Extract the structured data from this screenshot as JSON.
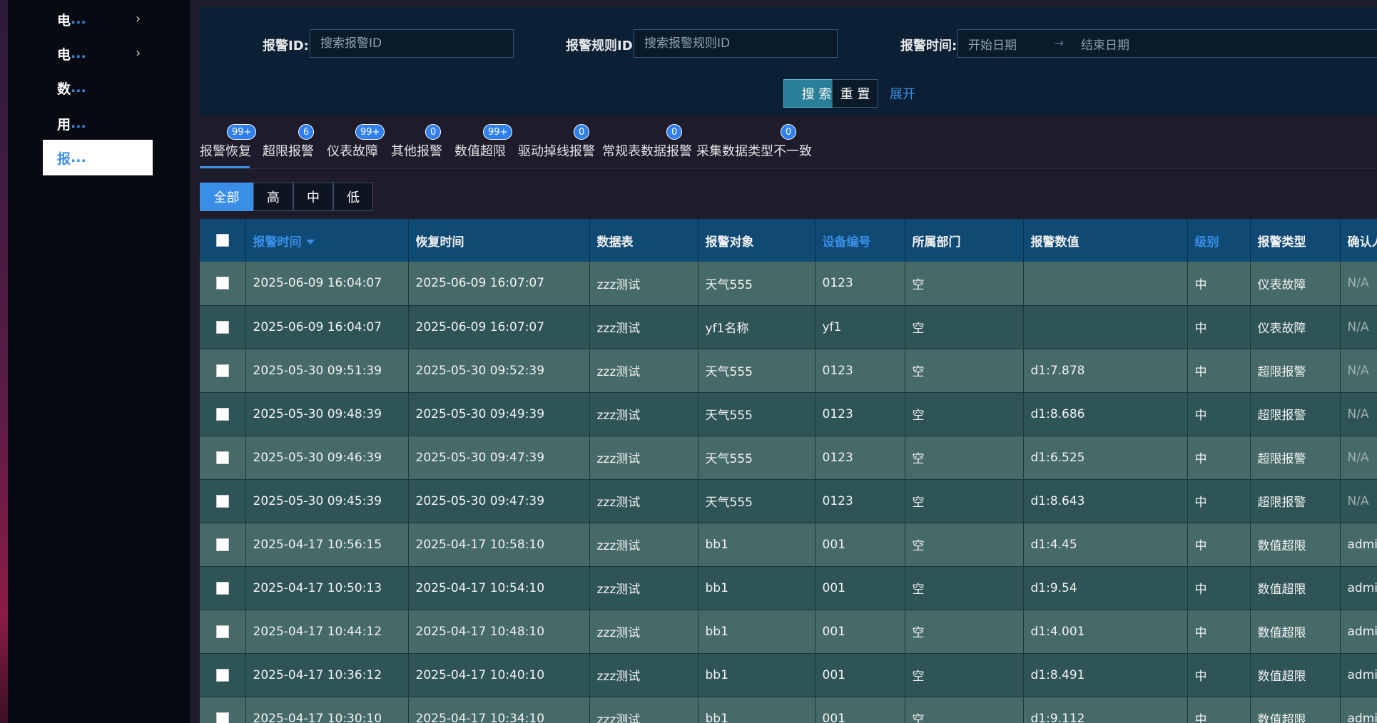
{
  "sidebar": {
    "items": [
      {
        "label": "电",
        "ellipsis": "...",
        "has_chevron": true,
        "active": false
      },
      {
        "label": "电",
        "ellipsis": "...",
        "has_chevron": true,
        "active": false
      },
      {
        "label": "数",
        "ellipsis": "...",
        "has_chevron": false,
        "active": false
      },
      {
        "label": "用",
        "ellipsis": "...",
        "has_chevron": false,
        "active": false
      },
      {
        "label": "报",
        "ellipsis": "...",
        "has_chevron": false,
        "active": true
      }
    ],
    "chevron": "›"
  },
  "search": {
    "alarm_id_label": "报警ID:",
    "alarm_id_placeholder": "搜索报警ID",
    "rule_id_label": "报警规则ID:",
    "rule_id_placeholder": "搜索报警规则ID",
    "time_label": "报警时间:",
    "start_date_placeholder": "开始日期",
    "date_separator": "→",
    "end_date_placeholder": "结束日期",
    "search_button": "搜 索",
    "reset_button": "重 置",
    "expand_link": "展开"
  },
  "tabs": [
    {
      "label": "报警恢复",
      "badge": "99+",
      "active": true
    },
    {
      "label": "超限报警",
      "badge": "6",
      "active": false
    },
    {
      "label": "仪表故障",
      "badge": "99+",
      "active": false
    },
    {
      "label": "其他报警",
      "badge": "0",
      "active": false
    },
    {
      "label": "数值超限",
      "badge": "99+",
      "active": false
    },
    {
      "label": "驱动掉线报警",
      "badge": "0",
      "active": false
    },
    {
      "label": "常规表数据报警",
      "badge": "0",
      "active": false
    },
    {
      "label": "采集数据类型不一致",
      "badge": "0",
      "active": false
    }
  ],
  "level_filter": [
    "全部",
    "高",
    "中",
    "低"
  ],
  "table": {
    "columns": [
      "报警时间",
      "恢复时间",
      "数据表",
      "报警对象",
      "设备编号",
      "所属部门",
      "报警数值",
      "级别",
      "报警类型",
      "确认人"
    ],
    "rows": [
      [
        "2025-06-09 16:04:07",
        "2025-06-09 16:07:07",
        "zzz测试",
        "天气555",
        "0123",
        "空",
        "",
        "中",
        "仪表故障",
        "N/A"
      ],
      [
        "2025-06-09 16:04:07",
        "2025-06-09 16:07:07",
        "zzz测试",
        "yf1名称",
        "yf1",
        "空",
        "",
        "中",
        "仪表故障",
        "N/A"
      ],
      [
        "2025-05-30 09:51:39",
        "2025-05-30 09:52:39",
        "zzz测试",
        "天气555",
        "0123",
        "空",
        "d1:7.878",
        "中",
        "超限报警",
        "N/A"
      ],
      [
        "2025-05-30 09:48:39",
        "2025-05-30 09:49:39",
        "zzz测试",
        "天气555",
        "0123",
        "空",
        "d1:8.686",
        "中",
        "超限报警",
        "N/A"
      ],
      [
        "2025-05-30 09:46:39",
        "2025-05-30 09:47:39",
        "zzz测试",
        "天气555",
        "0123",
        "空",
        "d1:6.525",
        "中",
        "超限报警",
        "N/A"
      ],
      [
        "2025-05-30 09:45:39",
        "2025-05-30 09:47:39",
        "zzz测试",
        "天气555",
        "0123",
        "空",
        "d1:8.643",
        "中",
        "超限报警",
        "N/A"
      ],
      [
        "2025-04-17 10:56:15",
        "2025-04-17 10:58:10",
        "zzz测试",
        "bb1",
        "001",
        "空",
        "d1:4.45",
        "中",
        "数值超限",
        "admin"
      ],
      [
        "2025-04-17 10:50:13",
        "2025-04-17 10:54:10",
        "zzz测试",
        "bb1",
        "001",
        "空",
        "d1:9.54",
        "中",
        "数值超限",
        "admin"
      ],
      [
        "2025-04-17 10:44:12",
        "2025-04-17 10:48:10",
        "zzz测试",
        "bb1",
        "001",
        "空",
        "d1:4.001",
        "中",
        "数值超限",
        "admin"
      ],
      [
        "2025-04-17 10:36:12",
        "2025-04-17 10:40:10",
        "zzz测试",
        "bb1",
        "001",
        "空",
        "d1:8.491",
        "中",
        "数值超限",
        "admin"
      ],
      [
        "2025-04-17 10:30:10",
        "2025-04-17 10:34:10",
        "zzz测试",
        "bb1",
        "001",
        "空",
        "d1:9.112",
        "中",
        "数值超限",
        "admin"
      ]
    ]
  },
  "colors": {
    "accent": "#3a8ee6",
    "row_odd": "#466a68",
    "row_even": "#2e5455",
    "header": "#0e4a73",
    "badge": "#2f80ed"
  }
}
